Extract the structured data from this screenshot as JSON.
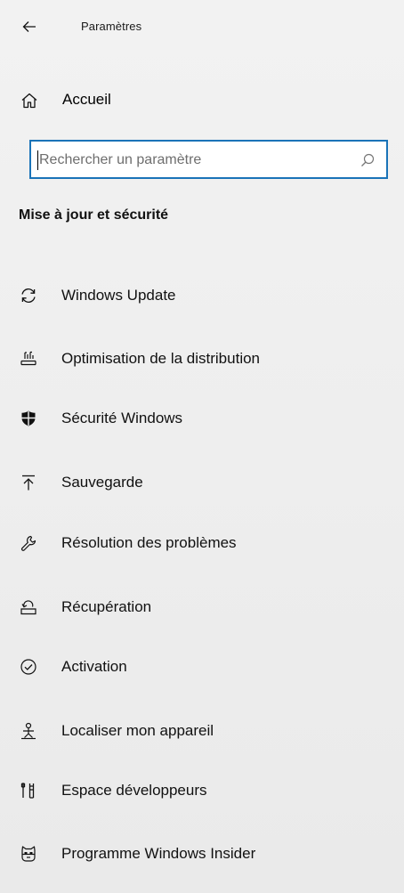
{
  "window": {
    "title": "Paramètres"
  },
  "home": {
    "label": "Accueil",
    "icon": "home-icon"
  },
  "search": {
    "placeholder": "Rechercher un paramètre",
    "icon": "search-icon",
    "focus_color": "#1a73b8"
  },
  "section": {
    "title": "Mise à jour et sécurité"
  },
  "nav": {
    "items": [
      {
        "label": "Windows Update",
        "icon": "sync-icon"
      },
      {
        "label": "Optimisation de la distribution",
        "icon": "delivery-optimization-icon"
      },
      {
        "label": "Sécurité Windows",
        "icon": "shield-icon"
      },
      {
        "label": "Sauvegarde",
        "icon": "backup-upload-icon"
      },
      {
        "label": "Résolution des problèmes",
        "icon": "wrench-icon"
      },
      {
        "label": "Récupération",
        "icon": "recovery-icon"
      },
      {
        "label": "Activation",
        "icon": "check-circle-icon"
      },
      {
        "label": "Localiser mon appareil",
        "icon": "find-device-icon"
      },
      {
        "label": "Espace développeurs",
        "icon": "developer-tools-icon"
      },
      {
        "label": "Programme Windows Insider",
        "icon": "insider-cat-icon"
      }
    ]
  }
}
